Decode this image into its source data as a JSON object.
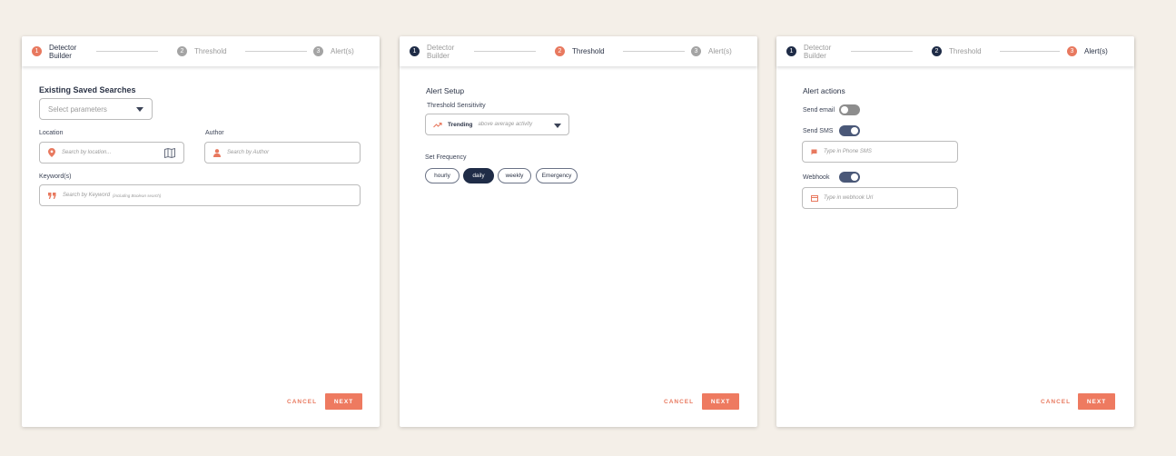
{
  "colors": {
    "background": "#f4efe8",
    "accent": "#ee7a60",
    "navy": "#1f2c47",
    "toggle_on": "#4a5878",
    "toggle_off": "#8d8d8d"
  },
  "steps": [
    {
      "number": "1",
      "label": "Detector Builder"
    },
    {
      "number": "2",
      "label": "Threshold"
    },
    {
      "number": "3",
      "label": "Alert(s)"
    }
  ],
  "panel1": {
    "title": "Existing Saved Searches",
    "select_placeholder": "Select parameters",
    "location_label": "Location",
    "location_placeholder": "Search by location...",
    "author_label": "Author",
    "author_placeholder": "Search by Author",
    "keyword_label": "Keyword(s)",
    "keyword_placeholder": "Search by Keyword",
    "keyword_hint": "(including Boolean search)",
    "icons": [
      "location-pin-icon",
      "map-icon",
      "person-icon",
      "quote-icon"
    ]
  },
  "panel2": {
    "title": "Alert Setup",
    "sensitivity_label": "Threshold Sensitivity",
    "sensitivity_value": "Trending",
    "sensitivity_desc": "above average activity",
    "frequency_label": "Set Frequency",
    "frequencies": [
      "hourly",
      "daily",
      "weekly",
      "Emergency"
    ],
    "selected_frequency": "daily"
  },
  "panel3": {
    "title": "Alert actions",
    "email_label": "Send email",
    "email_enabled": false,
    "sms_label": "Send SMS",
    "sms_enabled": true,
    "sms_placeholder": "Type in Phone SMS",
    "webhook_label": "Webhook",
    "webhook_enabled": true,
    "webhook_placeholder": "Type in webhook Url"
  },
  "actions": {
    "cancel": "CANCEL",
    "next": "NEXT"
  }
}
